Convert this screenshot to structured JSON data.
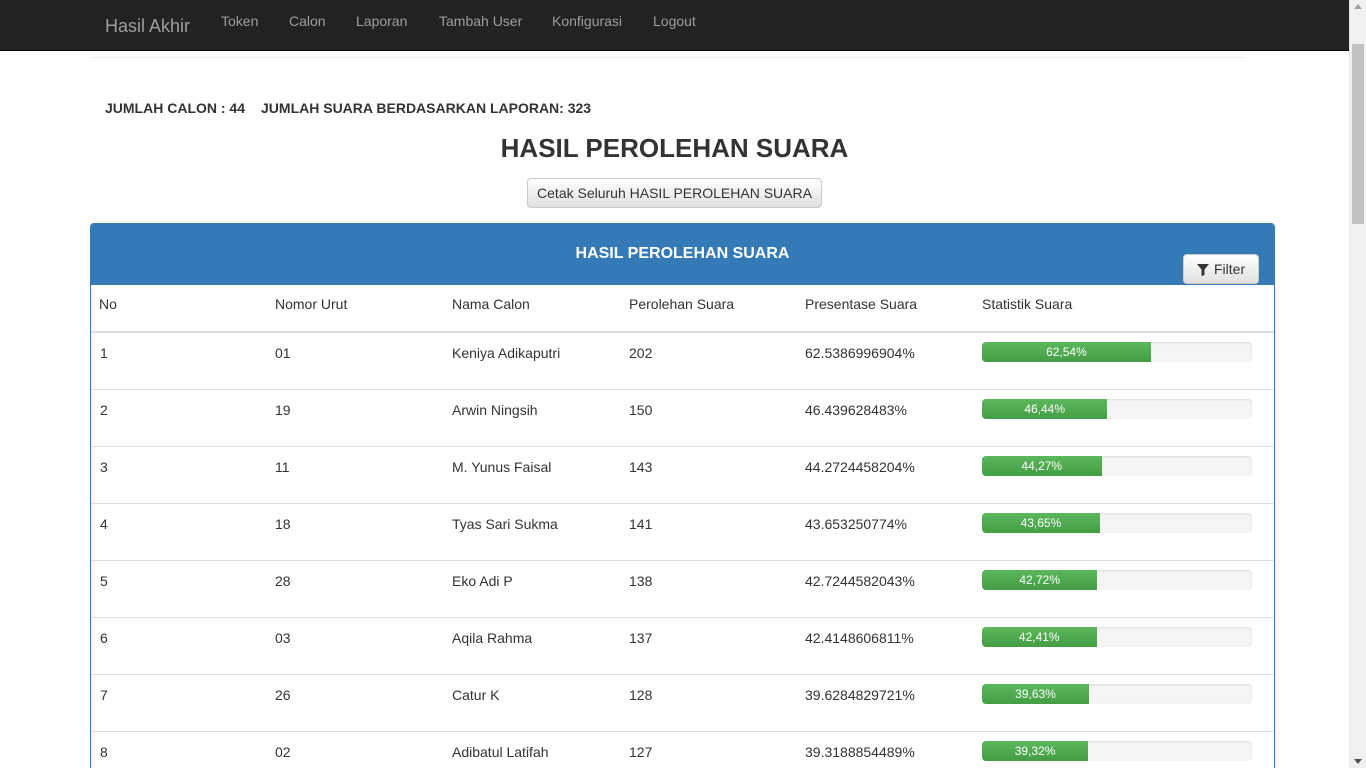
{
  "navbar": {
    "brand": "Hasil Akhir",
    "items": [
      "Token",
      "Calon",
      "Laporan",
      "Tambah User",
      "Konfigurasi",
      "Logout"
    ]
  },
  "summary": {
    "jumlah_calon": "JUMLAH CALON : 44",
    "jumlah_suara": "JUMLAH SUARA BERDASARKAN LAPORAN: 323"
  },
  "page_title": "HASIL PEROLEHAN SUARA",
  "print_button": "Cetak Seluruh HASIL PEROLEHAN SUARA",
  "panel": {
    "title": "HASIL PEROLEHAN SUARA",
    "filter_label": "Filter",
    "filter_icon": "filter-icon"
  },
  "table": {
    "headers": [
      "No",
      "Nomor Urut",
      "Nama Calon",
      "Perolehan Suara",
      "Presentase Suara",
      "Statistik Suara"
    ],
    "rows": [
      {
        "no": "1",
        "nomor_urut": "01",
        "nama": "Keniya Adikaputri",
        "suara": "202",
        "presentase": "62.5386996904%",
        "statistik": "62,54%",
        "fill": 62.54
      },
      {
        "no": "2",
        "nomor_urut": "19",
        "nama": "Arwin Ningsih",
        "suara": "150",
        "presentase": "46.439628483%",
        "statistik": "46,44%",
        "fill": 46.44
      },
      {
        "no": "3",
        "nomor_urut": "11",
        "nama": "M. Yunus Faisal",
        "suara": "143",
        "presentase": "44.2724458204%",
        "statistik": "44,27%",
        "fill": 44.27
      },
      {
        "no": "4",
        "nomor_urut": "18",
        "nama": "Tyas Sari Sukma",
        "suara": "141",
        "presentase": "43.653250774%",
        "statistik": "43,65%",
        "fill": 43.65
      },
      {
        "no": "5",
        "nomor_urut": "28",
        "nama": "Eko Adi P",
        "suara": "138",
        "presentase": "42.7244582043%",
        "statistik": "42,72%",
        "fill": 42.72
      },
      {
        "no": "6",
        "nomor_urut": "03",
        "nama": "Aqila Rahma",
        "suara": "137",
        "presentase": "42.4148606811%",
        "statistik": "42,41%",
        "fill": 42.41
      },
      {
        "no": "7",
        "nomor_urut": "26",
        "nama": "Catur K",
        "suara": "128",
        "presentase": "39.6284829721%",
        "statistik": "39,63%",
        "fill": 39.63
      },
      {
        "no": "8",
        "nomor_urut": "02",
        "nama": "Adibatul Latifah",
        "suara": "127",
        "presentase": "39.3188854489%",
        "statistik": "39,32%",
        "fill": 39.32
      }
    ]
  },
  "colors": {
    "navbar_bg": "#222222",
    "nav_text": "#9d9d9d",
    "panel_primary": "#337ab7",
    "progress_success": "#5cb85c"
  }
}
